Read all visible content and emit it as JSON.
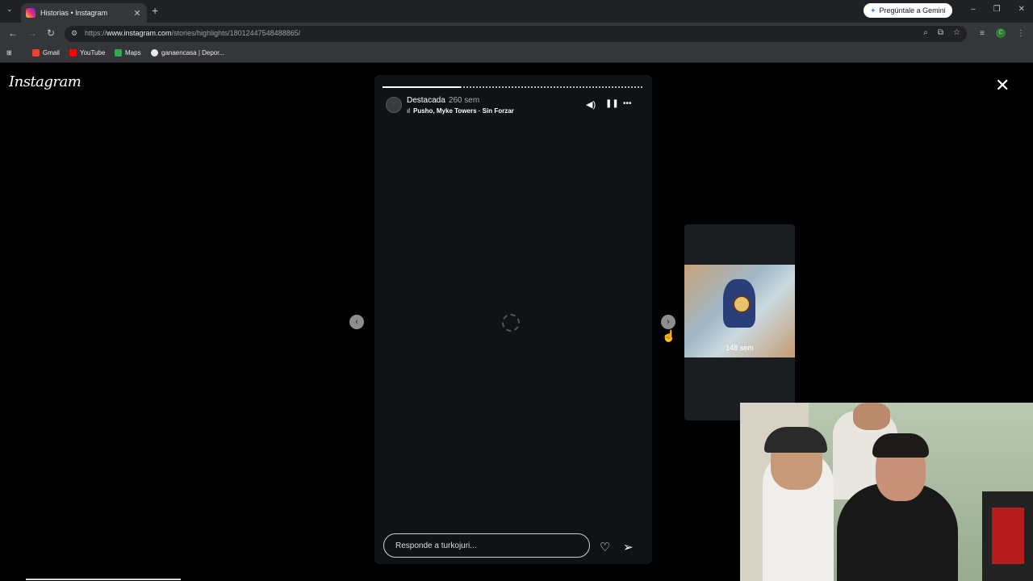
{
  "browser": {
    "tab_title": "Historias • Instagram",
    "new_tab": "+",
    "gemini_label": "Pregúntale a Gemini",
    "url_prefix": "https://",
    "url_domain": "www.instagram.com",
    "url_path": "/stories/highlights/18012447548488865/",
    "profile_initial": "C",
    "bookmarks": [
      {
        "label": "Gmail",
        "color": "#ea4335"
      },
      {
        "label": "YouTube",
        "color": "#ff0000"
      },
      {
        "label": "Maps",
        "color": "#34a853"
      },
      {
        "label": "ganaencasa | Depor...",
        "color": "#e8eaed"
      }
    ]
  },
  "instagram": {
    "logo": "Instagram",
    "close": "✕"
  },
  "story": {
    "username": "Destacada",
    "time_ago": "260 sem",
    "music": "Pusho, Myke Towers · Sin Forzar",
    "progress_fraction": 0.3,
    "reply_placeholder": "Responde a turkojuri..."
  },
  "next_story": {
    "time_ago": "148 sem"
  },
  "icons": {
    "prev_arrow": "‹",
    "next_arrow": "›",
    "heart": "♡",
    "send": "➢",
    "mute": "🔊",
    "pause": "❚❚",
    "more": "•••"
  }
}
